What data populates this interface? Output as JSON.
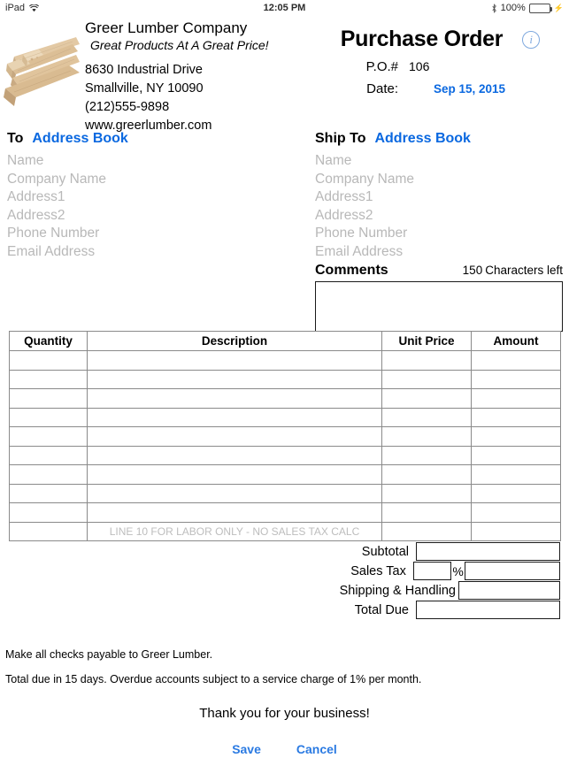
{
  "status_bar": {
    "device": "iPad",
    "wifi_icon": "wifi-icon",
    "time": "12:05 PM",
    "bluetooth_icon": "bluetooth-icon",
    "battery_percent": "100%",
    "battery_icon": "battery-icon",
    "charging_icon": "lightning-bolt-icon"
  },
  "company": {
    "logo_icon": "lumber-stack-logo",
    "name": "Greer Lumber Company",
    "tagline": "Great Products At A Great Price!",
    "address1": "8630 Industrial Drive",
    "address2": "Smallville, NY 10090",
    "phone": "(212)555-9898",
    "website": "www.greerlumber.com"
  },
  "document": {
    "title": "Purchase Order",
    "info_icon": "info-icon",
    "po_label": "P.O.#",
    "po_number": "106",
    "date_label": "Date:",
    "date_value": "Sep 15, 2015",
    "date_color": "#0a68e0"
  },
  "bill_to": {
    "heading": "To",
    "address_book_link": "Address Book",
    "fields": [
      "Name",
      "Company Name",
      "Address1",
      "Address2",
      "Phone Number",
      "Email Address"
    ]
  },
  "ship_to": {
    "heading": "Ship To",
    "address_book_link": "Address Book",
    "fields": [
      "Name",
      "Company Name",
      "Address1",
      "Address2",
      "Phone Number",
      "Email Address"
    ]
  },
  "comments": {
    "label": "Comments",
    "characters_left_count": "150",
    "characters_left_label": "Characters left",
    "value": ""
  },
  "line_items": {
    "headers": [
      "Quantity",
      "Description",
      "Unit Price",
      "Amount"
    ],
    "rows": [
      {
        "quantity": "",
        "description": "",
        "unit_price": "",
        "amount": ""
      },
      {
        "quantity": "",
        "description": "",
        "unit_price": "",
        "amount": ""
      },
      {
        "quantity": "",
        "description": "",
        "unit_price": "",
        "amount": ""
      },
      {
        "quantity": "",
        "description": "",
        "unit_price": "",
        "amount": ""
      },
      {
        "quantity": "",
        "description": "",
        "unit_price": "",
        "amount": ""
      },
      {
        "quantity": "",
        "description": "",
        "unit_price": "",
        "amount": ""
      },
      {
        "quantity": "",
        "description": "",
        "unit_price": "",
        "amount": ""
      },
      {
        "quantity": "",
        "description": "",
        "unit_price": "",
        "amount": ""
      },
      {
        "quantity": "",
        "description": "",
        "unit_price": "",
        "amount": ""
      },
      {
        "quantity": "",
        "description": "",
        "unit_price": "",
        "amount": ""
      }
    ],
    "labor_row_note": "LINE 10 FOR LABOR ONLY - NO SALES TAX CALC"
  },
  "totals": {
    "subtotal_label": "Subtotal",
    "subtotal_value": "",
    "sales_tax_label": "Sales Tax",
    "sales_tax_rate": "",
    "percent_sign": "%",
    "sales_tax_value": "",
    "shipping_label": "Shipping & Handling",
    "shipping_value": "",
    "total_due_label": "Total Due",
    "total_due_value": ""
  },
  "footer": {
    "note1": "Make all checks payable to Greer Lumber.",
    "note2": "Total due in 15 days. Overdue accounts subject to a service charge of 1% per month.",
    "thanks": "Thank you for your business!",
    "save_label": "Save",
    "cancel_label": "Cancel",
    "link_color": "#2a7ae2"
  }
}
